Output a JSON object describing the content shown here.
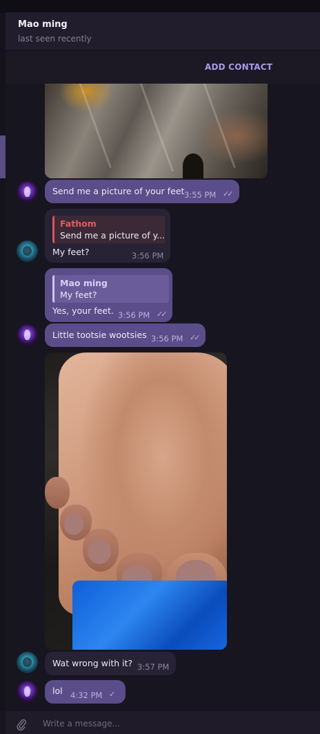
{
  "header": {
    "contact_name": "Mao ming",
    "status": "last seen recently",
    "add_contact_label": "ADD CONTACT"
  },
  "messages": [
    {
      "sender": "Mao ming",
      "direction": "out",
      "type": "photo",
      "description": "glass bottle close-up"
    },
    {
      "sender": "Mao ming",
      "direction": "out",
      "text": "Send me a picture of your feet",
      "time": "3:55 PM",
      "status": "read"
    },
    {
      "sender": "Fathom",
      "direction": "in",
      "reply_to": {
        "name": "Fathom",
        "text": "Send me a picture of y..."
      },
      "text": "My feet?",
      "time": "3:56 PM"
    },
    {
      "sender": "Mao ming",
      "direction": "out",
      "reply_to": {
        "name": "Mao ming",
        "text": "My feet?"
      },
      "text": "Yes, your feet.",
      "time": "3:56 PM",
      "status": "read"
    },
    {
      "sender": "Mao ming",
      "direction": "out",
      "text": "Little tootsie wootsies",
      "time": "3:56 PM",
      "status": "read"
    },
    {
      "sender": "Fathom",
      "direction": "in",
      "type": "photo",
      "description": "photo of toes"
    },
    {
      "sender": "Fathom",
      "direction": "in",
      "text": "Wat wrong with it?",
      "time": "3:57 PM"
    },
    {
      "sender": "Mao ming",
      "direction": "out",
      "text": "lol",
      "time": "4:32 PM",
      "status": "sent"
    }
  ],
  "composer": {
    "placeholder": "Write a message..."
  },
  "colors": {
    "outgoing_bubble": "#5b4d8a",
    "incoming_bubble": "#272335",
    "accent": "#a89be8",
    "reply_red": "#e0525a"
  },
  "icons": {
    "attach": "paperclip-icon",
    "read_receipt": "double-check-icon",
    "sent_receipt": "single-check-icon"
  }
}
